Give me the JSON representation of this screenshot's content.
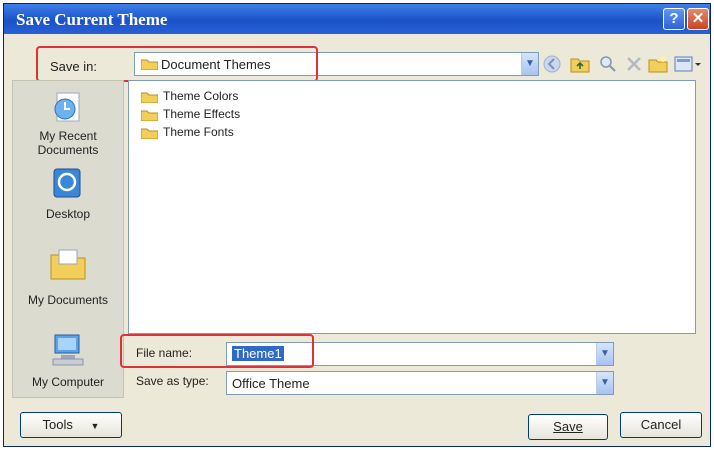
{
  "window": {
    "title": "Save Current Theme",
    "help_glyph": "?",
    "close_glyph": "✕"
  },
  "save_in": {
    "label": "Save in:",
    "value": "Document Themes"
  },
  "toolbar": {
    "icons": [
      "back-icon",
      "up-folder-icon",
      "search-web-icon",
      "delete-icon",
      "new-folder-icon",
      "views-icon"
    ]
  },
  "places": [
    {
      "icon": "my-recent-documents-icon",
      "label_line1": "My Recent",
      "label_line2": "Documents"
    },
    {
      "icon": "desktop-icon",
      "label_line1": "Desktop",
      "label_line2": ""
    },
    {
      "icon": "my-documents-icon",
      "label_line1": "My Documents",
      "label_line2": ""
    },
    {
      "icon": "my-computer-icon",
      "label_line1": "My Computer",
      "label_line2": ""
    }
  ],
  "files": [
    {
      "name": "Theme Colors"
    },
    {
      "name": "Theme Effects"
    },
    {
      "name": "Theme Fonts"
    }
  ],
  "file_name": {
    "label": "File name:",
    "value": "Theme1"
  },
  "save_as_type": {
    "label": "Save as type:",
    "value": "Office Theme"
  },
  "buttons": {
    "tools": "Tools",
    "save": "Save",
    "cancel": "Cancel"
  },
  "colors": {
    "titlebar": "#2a5fd6",
    "dialog_bg": "#ece9d8",
    "highlight": "#e0303a",
    "folder": "#f2cf5b"
  }
}
